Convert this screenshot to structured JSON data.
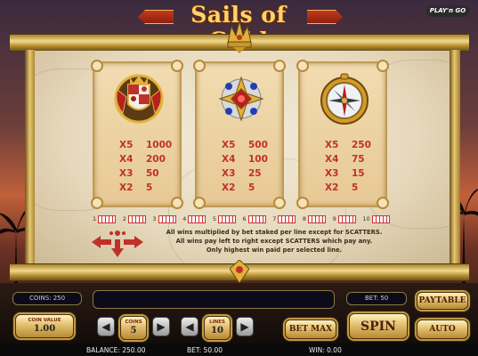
{
  "header": {
    "title": "Sails of Gold",
    "brand": "PLAY'n GO"
  },
  "paytable": {
    "symbols": [
      {
        "icon": "coat-of-arms-icon",
        "payouts": [
          {
            "mult": "X5",
            "value": "1000"
          },
          {
            "mult": "X4",
            "value": "200"
          },
          {
            "mult": "X3",
            "value": "50"
          },
          {
            "mult": "X2",
            "value": "5"
          }
        ]
      },
      {
        "icon": "jewel-brooch-icon",
        "payouts": [
          {
            "mult": "X5",
            "value": "500"
          },
          {
            "mult": "X4",
            "value": "100"
          },
          {
            "mult": "X3",
            "value": "25"
          },
          {
            "mult": "X2",
            "value": "5"
          }
        ]
      },
      {
        "icon": "compass-icon",
        "payouts": [
          {
            "mult": "X5",
            "value": "250"
          },
          {
            "mult": "X4",
            "value": "75"
          },
          {
            "mult": "X3",
            "value": "15"
          },
          {
            "mult": "X2",
            "value": "5"
          }
        ]
      }
    ],
    "lines": [
      "1",
      "2",
      "3",
      "4",
      "5",
      "6",
      "7",
      "8",
      "9",
      "10"
    ],
    "rules": [
      "All wins multiplied by bet staked per line except for SCATTERS.",
      "All wins pay left to right except SCATTERS which pay any.",
      "Only highest win paid per selected line."
    ]
  },
  "controls": {
    "coins_display": "COINS: 250",
    "bet_display": "BET: 50",
    "paytable_button": "PAYTABLE",
    "coin_value_label": "COIN VALUE",
    "coin_value": "1.00",
    "coins_label": "COINS",
    "coins_value": "5",
    "lines_label": "LINES",
    "lines_value": "10",
    "bet_max_button": "BET MAX",
    "spin_button": "SPIN",
    "auto_play_button": "AUTO PLAY",
    "decrease_symbol": "◀",
    "increase_symbol": "▶"
  },
  "status": {
    "balance": "BALANCE: 250.00",
    "bet": "BET: 50.00",
    "win": "WIN: 0.00"
  },
  "colors": {
    "payout_text": "#c0302b",
    "gold": "#e3bf70",
    "panel_bg": "#0b0b1a"
  }
}
